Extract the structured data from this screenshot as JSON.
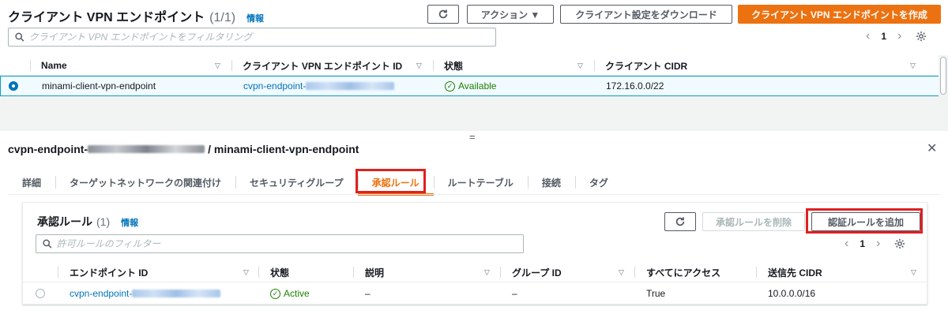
{
  "endpoints": {
    "title": "クライアント VPN エンドポイント",
    "count": "(1/1)",
    "info": "情報",
    "refresh_icon": "refresh-icon",
    "actions_label": "アクション ▼",
    "download_label": "クライアント設定をダウンロード",
    "create_label": "クライアント VPN エンドポイントを作成",
    "search_placeholder": "クライアント VPN エンドポイントをフィルタリング",
    "page": "1",
    "columns": [
      "Name",
      "クライアント VPN エンドポイント ID",
      "状態",
      "クライアント CIDR"
    ],
    "row": {
      "name": "minami-client-vpn-endpoint",
      "id_prefix": "cvpn-endpoint-",
      "status": "Available",
      "cidr": "172.16.0.0/22"
    }
  },
  "drag_handle": "=",
  "detail": {
    "id_prefix": "cvpn-endpoint-",
    "name": "/ minami-client-vpn-endpoint",
    "close": "✕",
    "tabs": [
      "詳細",
      "ターゲットネットワークの関連付け",
      "セキュリティグループ",
      "承認ルール",
      "ルートテーブル",
      "接続",
      "タグ"
    ],
    "active_tab": 3
  },
  "rules": {
    "title": "承認ルール",
    "count": "(1)",
    "info": "情報",
    "delete_label": "承認ルールを削除",
    "add_label": "認証ルールを追加",
    "search_placeholder": "許可ルールのフィルター",
    "page": "1",
    "columns": [
      "エンドポイント ID",
      "状態",
      "説明",
      "グループ ID",
      "すべてにアクセス",
      "送信先 CIDR"
    ],
    "row": {
      "id_prefix": "cvpn-endpoint-",
      "status": "Active",
      "description": "–",
      "group_id": "–",
      "access_all": "True",
      "dest_cidr": "10.0.0.0/16"
    }
  },
  "colors": {
    "accent": "#ec7211",
    "link": "#0073bb",
    "success": "#1d8102",
    "highlight": "#e02020"
  }
}
